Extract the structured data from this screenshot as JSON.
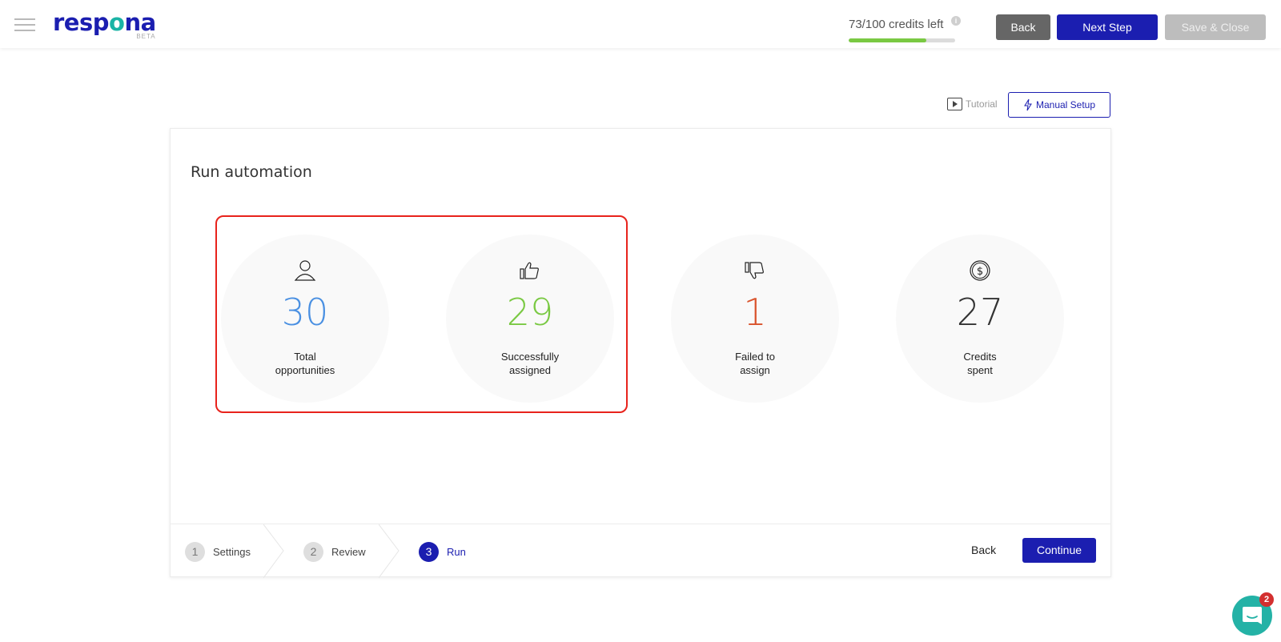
{
  "header": {
    "logo_text_pre": "resp",
    "logo_text_o": "o",
    "logo_text_post": "na",
    "logo_badge": "BETA",
    "credits_text": "73/100 credits left",
    "credits_used_fraction": 0.73,
    "info_icon": "i",
    "buttons": {
      "back": "Back",
      "next": "Next Step",
      "save": "Save & Close"
    }
  },
  "toolbar": {
    "tutorial_label": "Tutorial",
    "manual_setup_label": "Manual Setup"
  },
  "card": {
    "title": "Run automation",
    "stats": [
      {
        "icon": "user-icon",
        "value": "30",
        "label_line1": "Total",
        "label_line2": "opportunities",
        "color": "#4a90e2"
      },
      {
        "icon": "thumbs-up-icon",
        "value": "29",
        "label_line1": "Successfully",
        "label_line2": "assigned",
        "color": "#7ac943"
      },
      {
        "icon": "thumbs-down-icon",
        "value": "1",
        "label_line1": "Failed to",
        "label_line2": "assign",
        "color": "#d9532c"
      },
      {
        "icon": "dollar-coin-icon",
        "value": "27",
        "label_line1": "Credits",
        "label_line2": "spent",
        "color": "#333333"
      }
    ]
  },
  "footer": {
    "steps": [
      {
        "number": "1",
        "label": "Settings",
        "active": false
      },
      {
        "number": "2",
        "label": "Review",
        "active": false
      },
      {
        "number": "3",
        "label": "Run",
        "active": true
      }
    ],
    "back_label": "Back",
    "continue_label": "Continue"
  },
  "chat": {
    "badge_count": "2"
  },
  "colors": {
    "brand": "#1b1eb0",
    "accent": "#1bb3a5",
    "highlight": "#e8231c",
    "progress": "#7ac943"
  }
}
